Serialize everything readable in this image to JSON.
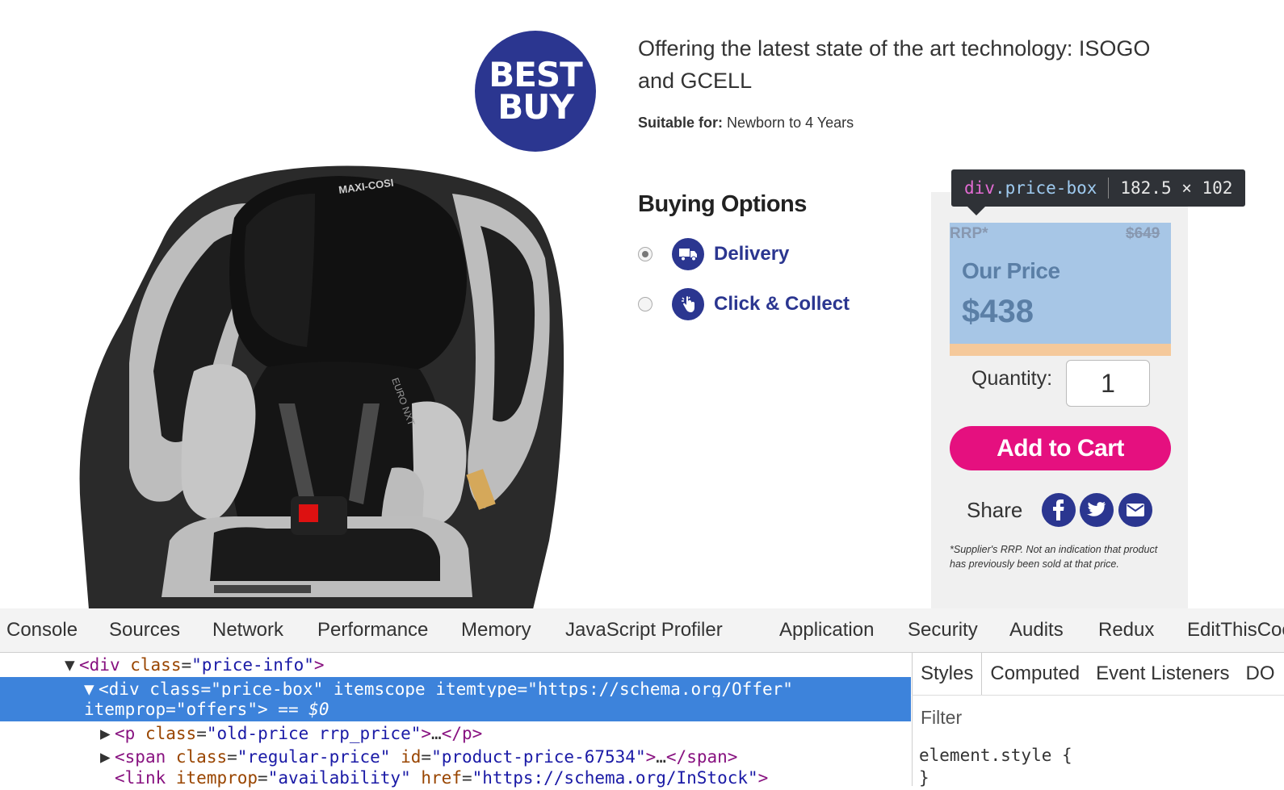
{
  "brand": {
    "logo_line1": "BEST",
    "logo_line2": "BUY",
    "primary": "#2b3690",
    "accent": "#e5107f"
  },
  "product": {
    "headline": "Offering the latest state of the art technology: ISOGO and GCELL",
    "suitable_label": "Suitable for:",
    "suitable_value": "Newborn to 4 Years",
    "image_alt": "car-seat-photo"
  },
  "buying": {
    "title": "Buying Options",
    "options": [
      {
        "label": "Delivery",
        "selected": true,
        "icon": "truck-icon"
      },
      {
        "label": "Click & Collect",
        "selected": false,
        "icon": "hand-pointer-icon"
      }
    ]
  },
  "price": {
    "rrp_label": "RRP*",
    "rrp_value": "$649",
    "our_price_label": "Our Price",
    "our_price_value": "$438"
  },
  "inspector_tooltip": {
    "tag": "div",
    "class": ".price-box",
    "size": "182.5 × 102"
  },
  "quantity": {
    "label": "Quantity:",
    "value": "1"
  },
  "cart": {
    "label": "Add to Cart"
  },
  "share": {
    "label": "Share",
    "icons": [
      "facebook-icon",
      "twitter-icon",
      "email-icon"
    ]
  },
  "note": "*Supplier's RRP. Not an indication that product has previously been sold at that price.",
  "devtools": {
    "tabs": [
      "Console",
      "Sources",
      "Network",
      "Performance",
      "Memory",
      "JavaScript Profiler",
      "Application",
      "Security",
      "Audits",
      "Redux",
      "EditThisCoo"
    ],
    "dom": {
      "r1_tag": "div",
      "r1_attr": "class",
      "r1_val": "price-info",
      "r2_tag": "div",
      "r2_attr1": "class",
      "r2_val1": "price-box",
      "r2_attr2": "itemscope",
      "r2_attr3": "itemtype",
      "r2_val3": "https://schema.org/Offer",
      "r2b_attr": "itemprop",
      "r2b_val": "offers",
      "r2b_suffix": "== $0",
      "r3_tag": "p",
      "r3_attr": "class",
      "r3_val": "old-price rrp_price",
      "r4_tag": "span",
      "r4_attr1": "class",
      "r4_val1": "regular-price",
      "r4_attr2": "id",
      "r4_val2": "product-price-67534",
      "r5_tag": "link",
      "r5_attr1": "itemprop",
      "r5_val1": "availability",
      "r5_attr2": "href",
      "r5_val2": "https://schema.org/InStock"
    },
    "side_tabs": [
      "Styles",
      "Computed",
      "Event Listeners",
      "DO"
    ],
    "filter_placeholder": "Filter",
    "element_style": "element.style {",
    "element_style_close": "}"
  }
}
